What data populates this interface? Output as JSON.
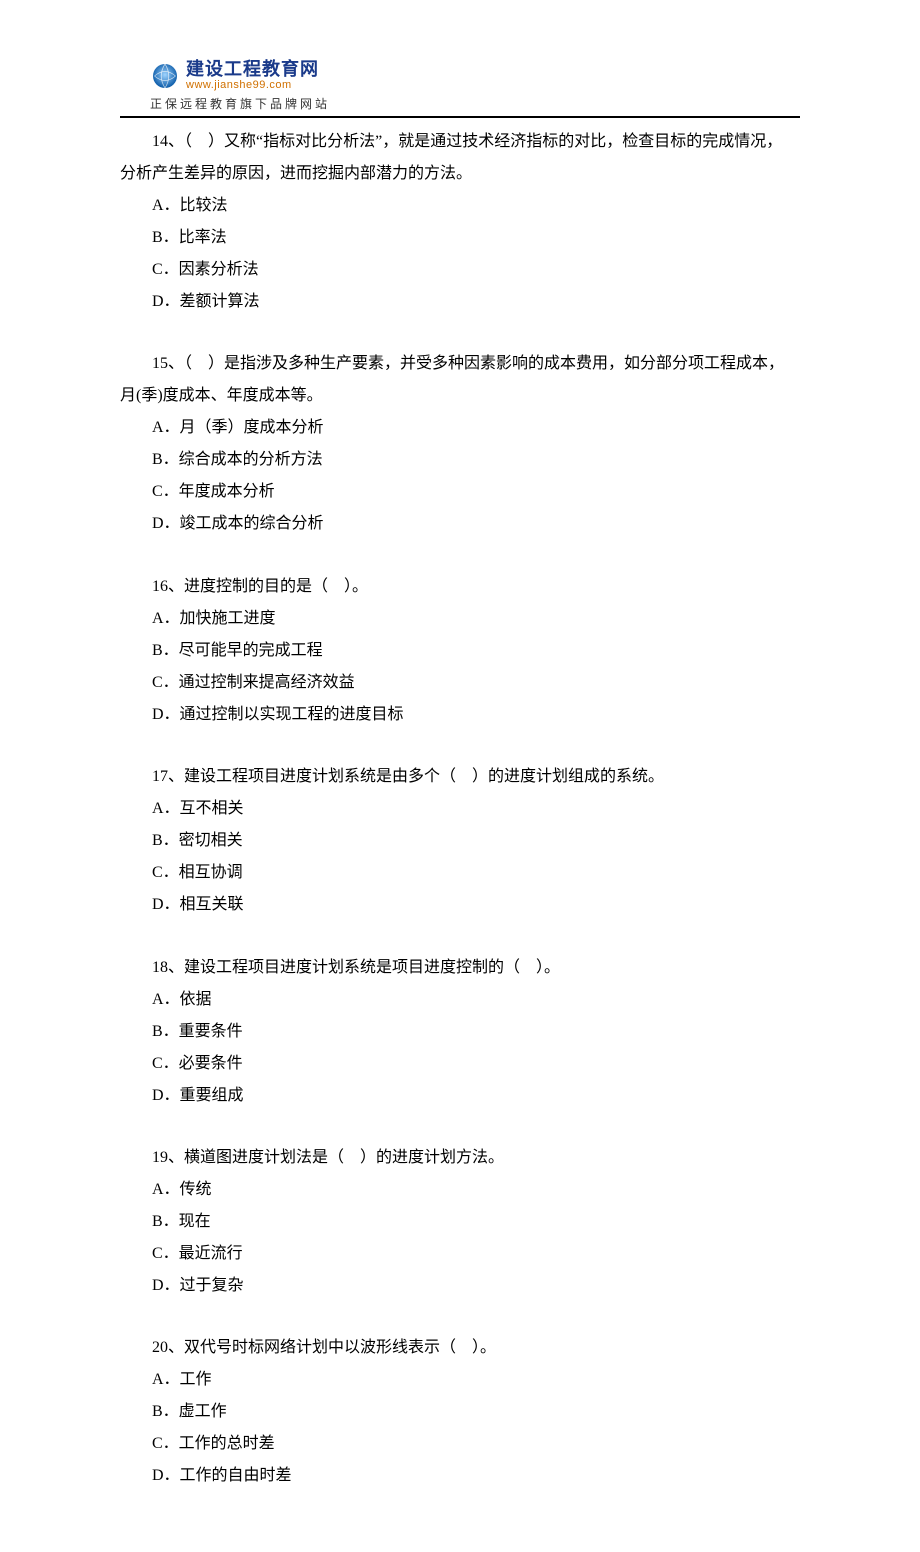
{
  "header": {
    "brand_cn": "建设工程教育网",
    "brand_url": "www.jianshe99.com",
    "brand_sub": "正保远程教育旗下品牌网站"
  },
  "questions": [
    {
      "stem_lines": [
        "14、（　）又称“指标对比分析法”，就是通过技术经济指标的对比，检查目标的完成情况，",
        "分析产生差异的原因，进而挖掘内部潜力的方法。"
      ],
      "options": [
        "A．比较法",
        "B．比率法",
        "C．因素分析法",
        "D．差额计算法"
      ]
    },
    {
      "stem_lines": [
        "15、（　）是指涉及多种生产要素，并受多种因素影响的成本费用，如分部分项工程成本，",
        "月(季)度成本、年度成本等。"
      ],
      "options": [
        "A．月（季）度成本分析",
        "B．综合成本的分析方法",
        "C．年度成本分析",
        "D．竣工成本的综合分析"
      ]
    },
    {
      "stem_lines": [
        "16、进度控制的目的是（　）。"
      ],
      "options": [
        "A．加快施工进度",
        "B．尽可能早的完成工程",
        "C．通过控制来提高经济效益",
        "D．通过控制以实现工程的进度目标"
      ]
    },
    {
      "stem_lines": [
        "17、建设工程项目进度计划系统是由多个（　）的进度计划组成的系统。"
      ],
      "options": [
        "A．互不相关",
        "B．密切相关",
        "C．相互协调",
        "D．相互关联"
      ]
    },
    {
      "stem_lines": [
        "18、建设工程项目进度计划系统是项目进度控制的（　）。"
      ],
      "options": [
        "A．依据",
        "B．重要条件",
        "C．必要条件",
        "D．重要组成"
      ]
    },
    {
      "stem_lines": [
        "19、横道图进度计划法是（　）的进度计划方法。"
      ],
      "options": [
        "A．传统",
        "B．现在",
        "C．最近流行",
        "D．过于复杂"
      ]
    },
    {
      "stem_lines": [
        "20、双代号时标网络计划中以波形线表示（　）。"
      ],
      "options": [
        "A．工作",
        "B．虚工作",
        "C．工作的总时差",
        "D．工作的自由时差"
      ]
    }
  ]
}
